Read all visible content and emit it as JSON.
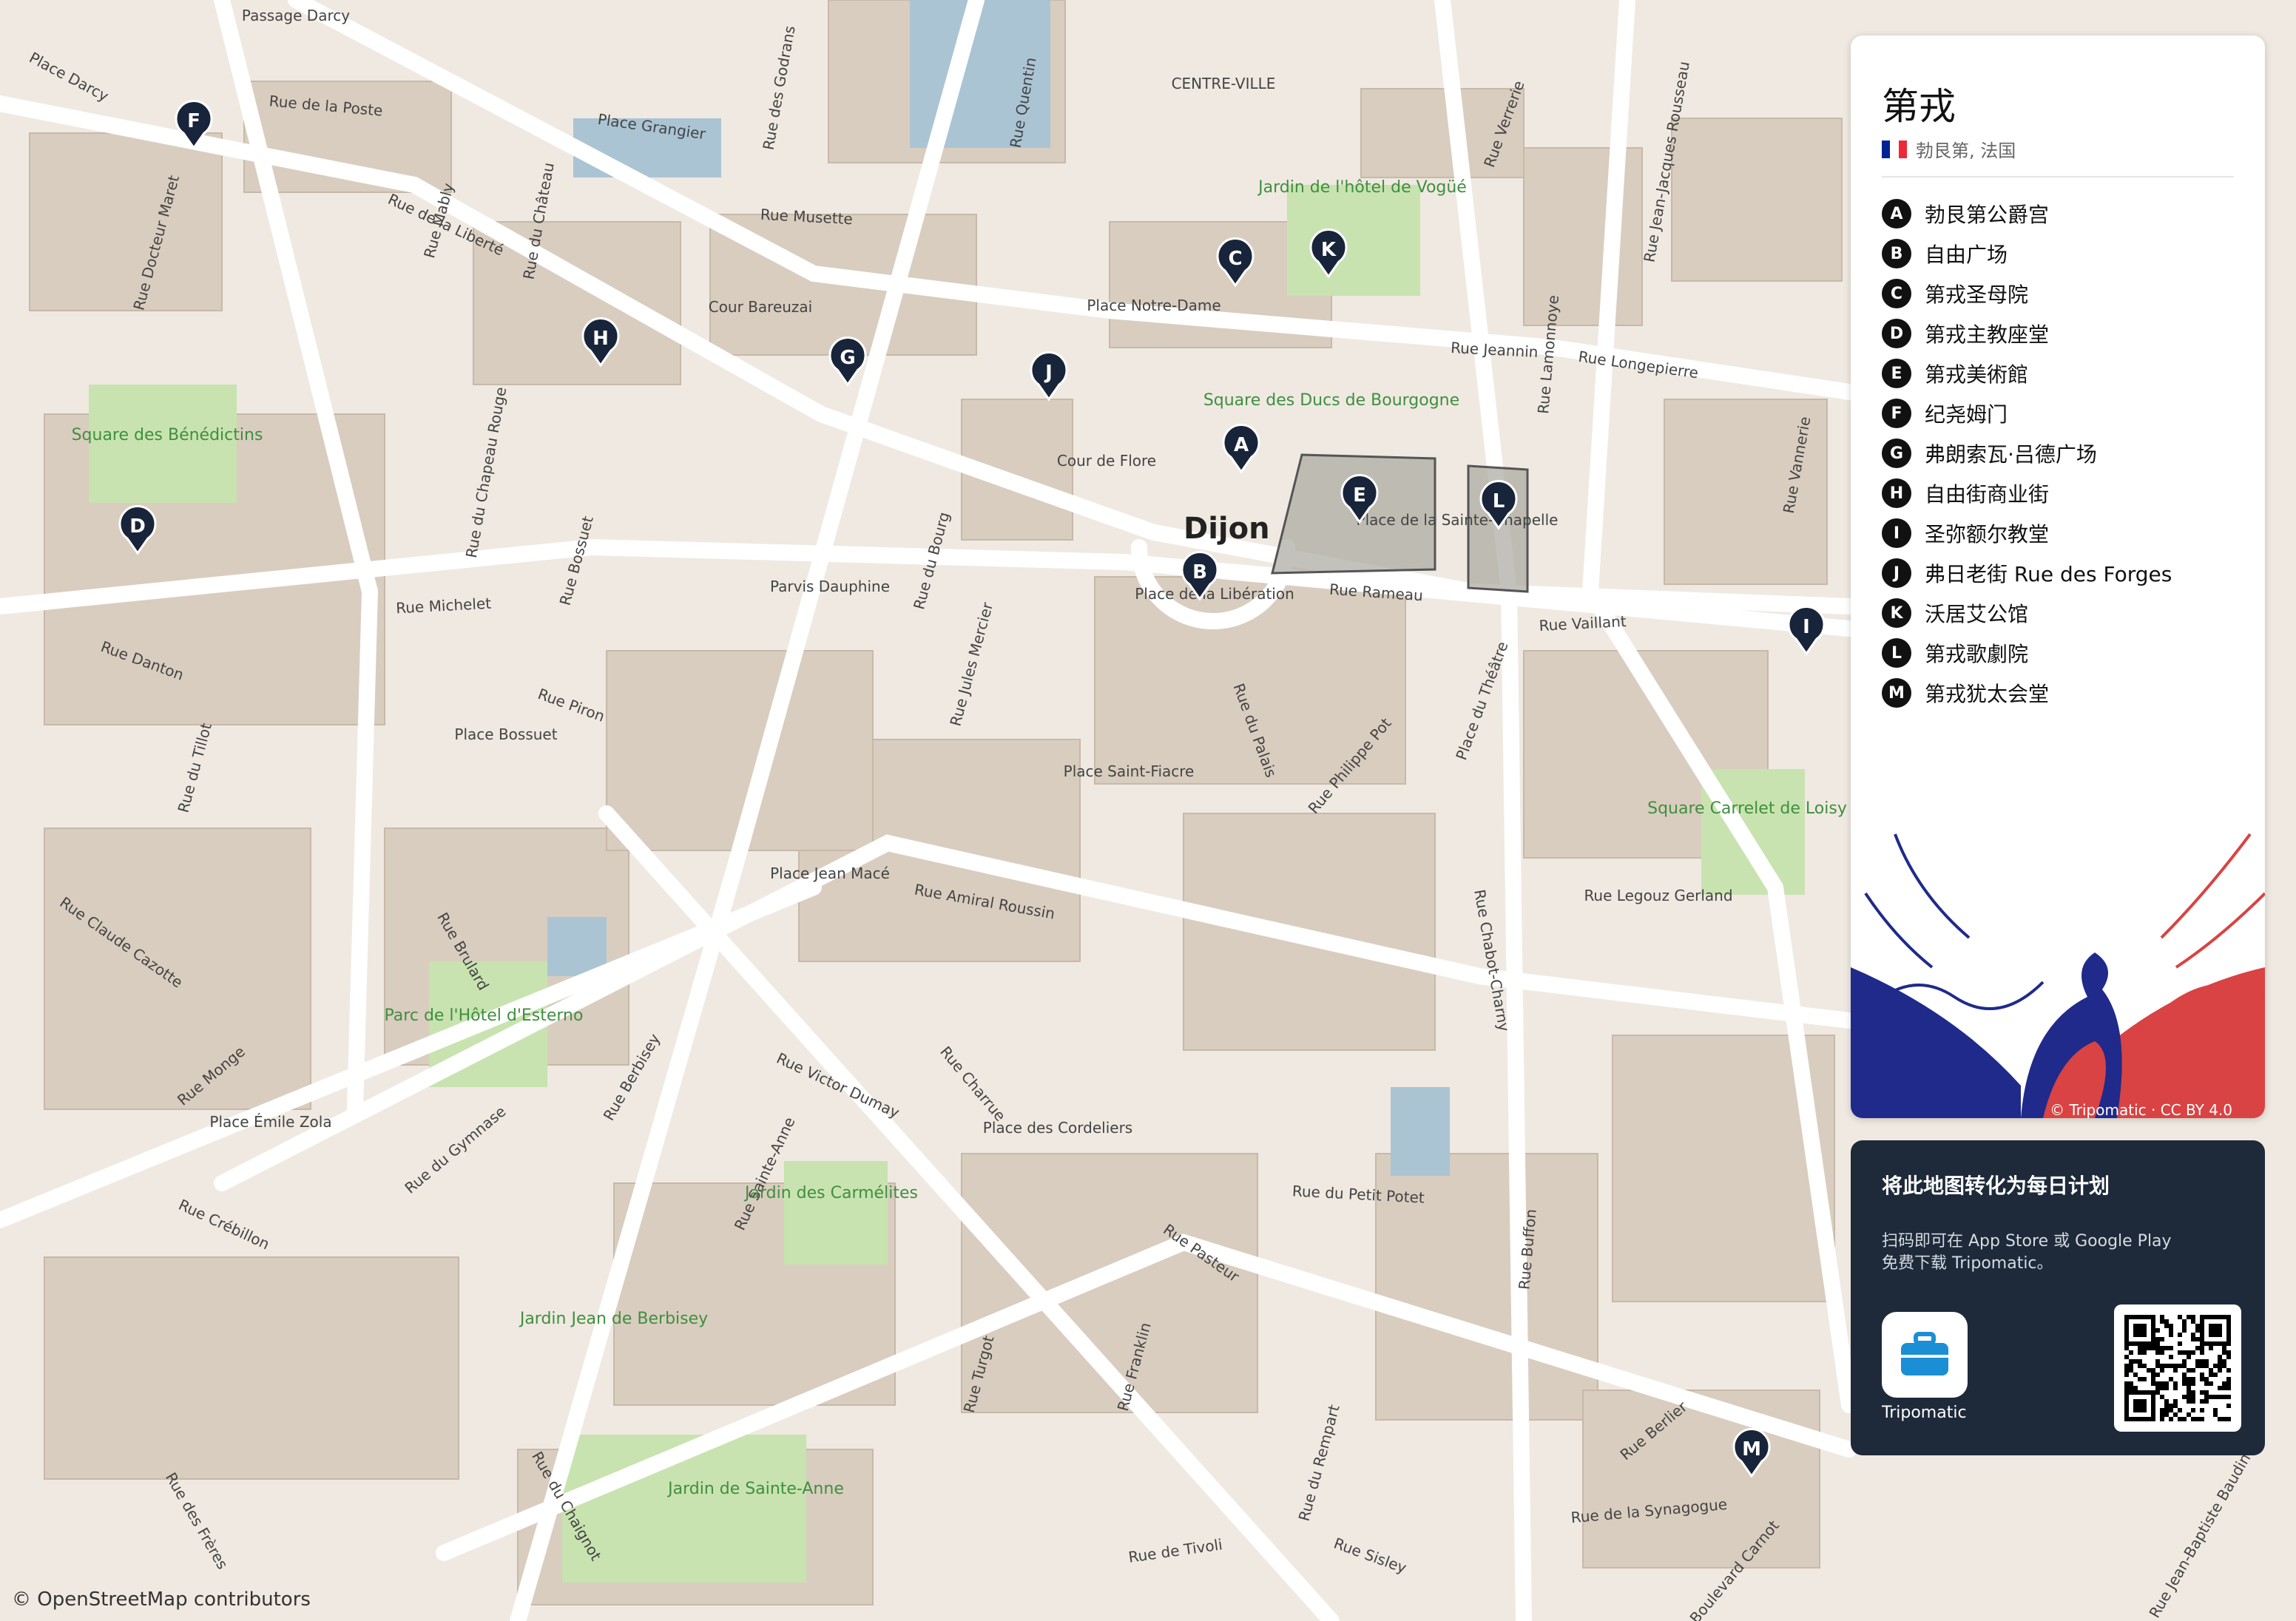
{
  "map": {
    "attribution": "© OpenStreetMap contributors",
    "city_label": "Dijon",
    "street_labels": [
      "Passage Darcy",
      "Place Darcy",
      "Rue de la Poste",
      "Place Grangier",
      "Rue des Godrans",
      "Rue Quentin",
      "CENTRE-VILLE",
      "Rue Verrerie",
      "Rue Jean-Jacques Rousseau",
      "Rue de la Liberté",
      "Rue Musette",
      "Rue du Château",
      "Rue Mably",
      "Rue Docteur Maret",
      "Cour Bareuzai",
      "Place Notre-Dame",
      "Rue Jeannin",
      "Rue Lamonnoye",
      "Rue Longepierre",
      "Cour de Flore",
      "Place de la Sainte-Chapelle",
      "Rue Rameau",
      "Rue Vaillant",
      "Place du Théâtre",
      "Rue Michelet",
      "Rue Danton",
      "Parvis Dauphine",
      "Rue du Bourg",
      "Rue Jules Mercier",
      "Place de la Libération",
      "Rue Piron",
      "Place Bossuet",
      "Rue du Palais",
      "Rue Philippe Pot",
      "Place Saint-Fiacre",
      "Rue Amiral Roussin",
      "Place Jean Macé",
      "Rue Legouz Gerland",
      "Rue Chabot-Charny",
      "Rue Claude Cazotte",
      "Rue Brulard",
      "Rue Monge",
      "Rue Berbisey",
      "Rue Victor Dumay",
      "Rue Charrue",
      "Place des Cordeliers",
      "Rue du Petit Potet",
      "Rue Buffon",
      "Rue Crébillon",
      "Rue du Gymnase",
      "Place Émile Zola",
      "Rue Sainte-Anne",
      "Rue Pasteur",
      "Rue Turgot",
      "Rue Franklin",
      "Rue du Rempart",
      "Rue Berlier",
      "Rue de la Synagogue",
      "Rue de Tivoli",
      "Rue Sisley",
      "Boulevard Carnot",
      "Rue du Chaignot",
      "Rue des Frères",
      "Rue Jean-Baptiste Baudin",
      "Rue du Tillot",
      "Rue Bossuet",
      "Rue du Chapeau Rouge",
      "Rue Vannerie"
    ],
    "park_labels": [
      "Square des Bénédictins",
      "Jardin de l'hôtel de Vogüé",
      "Square des Ducs de Bourgogne",
      "Square Carrelet de Loisy",
      "Parc de l'Hôtel d'Esterno",
      "Jardin des Carmélites",
      "Jardin Jean de Berbisey",
      "Jardin de Sainte-Anne"
    ],
    "pins": [
      "A",
      "B",
      "C",
      "D",
      "E",
      "F",
      "G",
      "H",
      "I",
      "J",
      "K",
      "L",
      "M"
    ]
  },
  "panel": {
    "title": "第戎",
    "subtitle": "勃艮第, 法国",
    "flag_colors": [
      "#002395",
      "#ffffff",
      "#ed2939"
    ],
    "pois": [
      {
        "letter": "A",
        "name": "勃艮第公爵宫"
      },
      {
        "letter": "B",
        "name": "自由广场"
      },
      {
        "letter": "C",
        "name": "第戎圣母院"
      },
      {
        "letter": "D",
        "name": "第戎主教座堂"
      },
      {
        "letter": "E",
        "name": "第戎美術館"
      },
      {
        "letter": "F",
        "name": "纪尧姆门"
      },
      {
        "letter": "G",
        "name": "弗朗索瓦·吕德广场"
      },
      {
        "letter": "H",
        "name": "自由街商业街"
      },
      {
        "letter": "I",
        "name": "圣弥额尔教堂"
      },
      {
        "letter": "J",
        "name": "弗日老街 Rue des Forges"
      },
      {
        "letter": "K",
        "name": "沃居艾公馆"
      },
      {
        "letter": "L",
        "name": "第戎歌劇院"
      },
      {
        "letter": "M",
        "name": "第戎犹太会堂"
      }
    ],
    "art_credit": "© Tripomatic · CC BY 4.0"
  },
  "cta": {
    "title": "将此地图转化为每日计划",
    "description": "扫码即可在 App Store 或 Google Play 免费下载 Tripomatic。",
    "app_name": "Tripomatic",
    "accent": "#1e2a3a",
    "icon_color": "#1a8fd6"
  }
}
